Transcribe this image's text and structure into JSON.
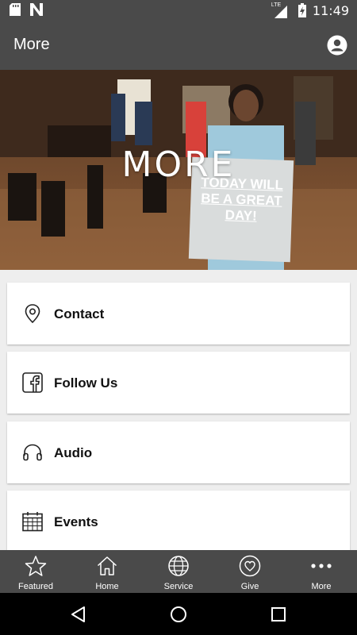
{
  "status_bar": {
    "time": "11:49",
    "network": "LTE",
    "icons": [
      "sd-card-icon",
      "notification-n-icon",
      "signal-icon",
      "battery-charging-icon"
    ]
  },
  "app_bar": {
    "title": "More",
    "profile_icon": "account-circle-icon"
  },
  "hero": {
    "title": "MORE",
    "sign_text": "TODAY WILL BE A GREAT DAY!"
  },
  "menu": {
    "items": [
      {
        "label": "Contact",
        "icon": "map-pin-icon"
      },
      {
        "label": "Follow Us",
        "icon": "facebook-icon"
      },
      {
        "label": "Audio",
        "icon": "headphones-icon"
      },
      {
        "label": "Events",
        "icon": "calendar-icon"
      }
    ]
  },
  "tabs": [
    {
      "label": "Featured",
      "icon": "star-icon"
    },
    {
      "label": "Home",
      "icon": "home-icon"
    },
    {
      "label": "Service",
      "icon": "globe-icon"
    },
    {
      "label": "Give",
      "icon": "heart-icon"
    },
    {
      "label": "More",
      "icon": "more-dots-icon"
    }
  ],
  "colors": {
    "bar": "#4a4a4a",
    "background": "#eeeeee",
    "card": "#ffffff",
    "nav": "#000000"
  }
}
